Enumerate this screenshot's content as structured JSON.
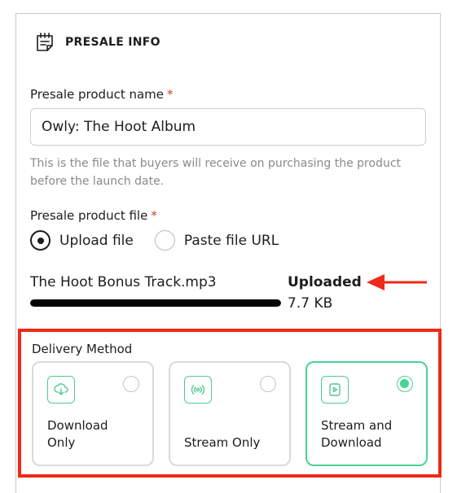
{
  "section": {
    "title": "PRESALE INFO",
    "icon": "document-note-icon"
  },
  "product_name": {
    "label": "Presale product name",
    "required_mark": "*",
    "value": "Owly: The Hoot Album",
    "help": "This is the file that buyers will receive on purchasing the product before the launch date."
  },
  "product_file": {
    "label": "Presale product file",
    "required_mark": "*",
    "options": [
      {
        "label": "Upload file",
        "selected": true
      },
      {
        "label": "Paste file URL",
        "selected": false
      }
    ],
    "file_name": "The Hoot Bonus Track.mp3",
    "status": "Uploaded",
    "size": "7.7 KB",
    "progress": 1.0
  },
  "delivery": {
    "label": "Delivery Method",
    "options": [
      {
        "label": "Download Only",
        "icon": "download-cloud-icon",
        "selected": false
      },
      {
        "label": "Stream Only",
        "icon": "broadcast-icon",
        "selected": false
      },
      {
        "label": "Stream and Download",
        "icon": "play-file-icon",
        "selected": true
      }
    ]
  },
  "colors": {
    "accent_green": "#45d494",
    "highlight_red": "#ef2a18",
    "required_red": "#d33a2c"
  }
}
